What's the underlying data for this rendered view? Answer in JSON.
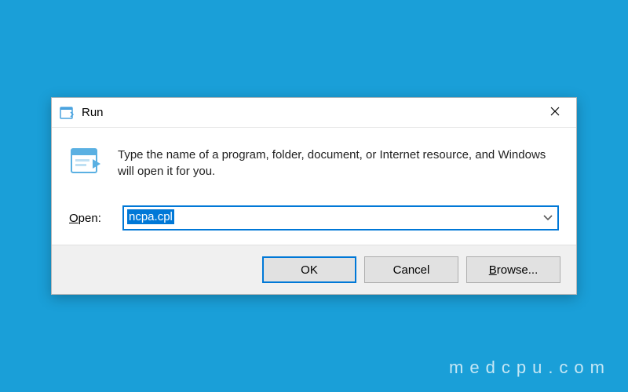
{
  "dialog": {
    "title": "Run",
    "description": "Type the name of a program, folder, document, or Internet resource, and Windows will open it for you.",
    "open_label_pre": "O",
    "open_label_post": "pen:",
    "input_value": "ncpa.cpl",
    "buttons": {
      "ok": "OK",
      "cancel": "Cancel",
      "browse_u": "B",
      "browse_rest": "rowse..."
    }
  },
  "watermark": "medcpu.com"
}
